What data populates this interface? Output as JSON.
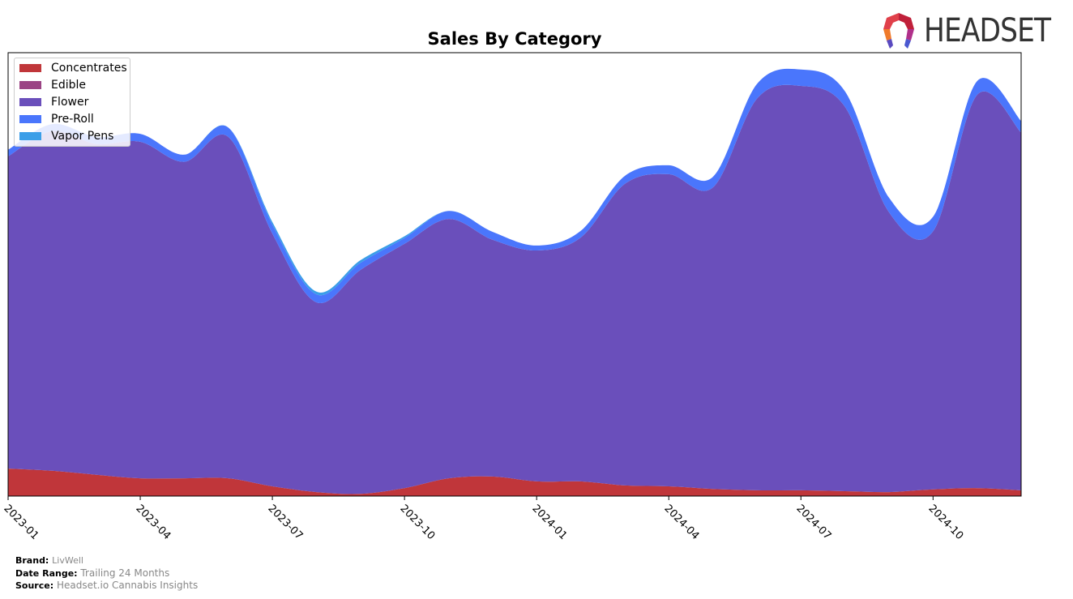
{
  "chart_data": {
    "type": "area",
    "stacked": true,
    "title": "Sales By Category",
    "xlabel": "",
    "ylabel": "",
    "x": [
      "2023-01",
      "2023-02",
      "2023-03",
      "2023-04",
      "2023-05",
      "2023-06",
      "2023-07",
      "2023-08",
      "2023-09",
      "2023-10",
      "2023-11",
      "2023-12",
      "2024-01",
      "2024-02",
      "2024-03",
      "2024-04",
      "2024-05",
      "2024-06",
      "2024-07",
      "2024-08",
      "2024-09",
      "2024-10",
      "2024-11",
      "2024-12"
    ],
    "xticks": [
      "2023-01",
      "2023-04",
      "2023-07",
      "2023-10",
      "2024-01",
      "2024-04",
      "2024-07",
      "2024-10"
    ],
    "ylim": [
      0,
      100
    ],
    "yticks_visible": false,
    "grid": false,
    "legend_position": "top-left",
    "series": [
      {
        "name": "Concentrates",
        "color": "#c0363a",
        "values": [
          6.2,
          5.7,
          4.8,
          4.0,
          4.0,
          4.0,
          2.2,
          0.9,
          0.5,
          1.8,
          4.0,
          4.4,
          3.3,
          3.3,
          2.4,
          2.2,
          1.6,
          1.3,
          1.3,
          1.1,
          0.9,
          1.5,
          1.8,
          1.3
        ]
      },
      {
        "name": "Edible",
        "color": "#9b4384",
        "values": [
          0,
          0,
          0,
          0,
          0,
          0,
          0,
          0,
          0,
          0,
          0,
          0,
          0,
          0,
          0,
          0,
          0,
          0,
          0,
          0,
          0,
          0,
          0,
          0
        ]
      },
      {
        "name": "Flower",
        "color": "#6a4fbb",
        "values": [
          70.4,
          76.6,
          74.6,
          75.9,
          71.4,
          77.0,
          57.0,
          42.8,
          50.5,
          55.1,
          58.5,
          53.4,
          52.1,
          55.0,
          68.0,
          70.4,
          68.0,
          88.3,
          91.2,
          86.7,
          63.1,
          58.2,
          88.7,
          80.7
        ]
      },
      {
        "name": "Pre-Roll",
        "color": "#4a76fc",
        "values": [
          1.5,
          1.6,
          1.6,
          1.8,
          1.6,
          2.1,
          2.0,
          1.8,
          1.6,
          1.3,
          1.8,
          1.8,
          1.1,
          1.5,
          1.8,
          2.0,
          2.4,
          3.3,
          3.7,
          3.5,
          3.3,
          3.3,
          3.1,
          2.6
        ]
      },
      {
        "name": "Vapor Pens",
        "color": "#3b9ee8",
        "values": [
          0,
          0,
          0,
          0,
          0,
          0,
          0.6,
          0.6,
          0.6,
          0.4,
          0,
          0,
          0,
          0,
          0,
          0,
          0,
          0,
          0,
          0,
          0,
          0,
          0,
          0
        ]
      }
    ]
  },
  "logo": {
    "text": "HEADSET"
  },
  "footer": {
    "brand_label": "Brand:",
    "brand_value": "LivWell",
    "date_range_label": "Date Range:",
    "date_range_value": "Trailing 24 Months",
    "source_label": "Source:",
    "source_value": "Headset.io Cannabis Insights"
  }
}
